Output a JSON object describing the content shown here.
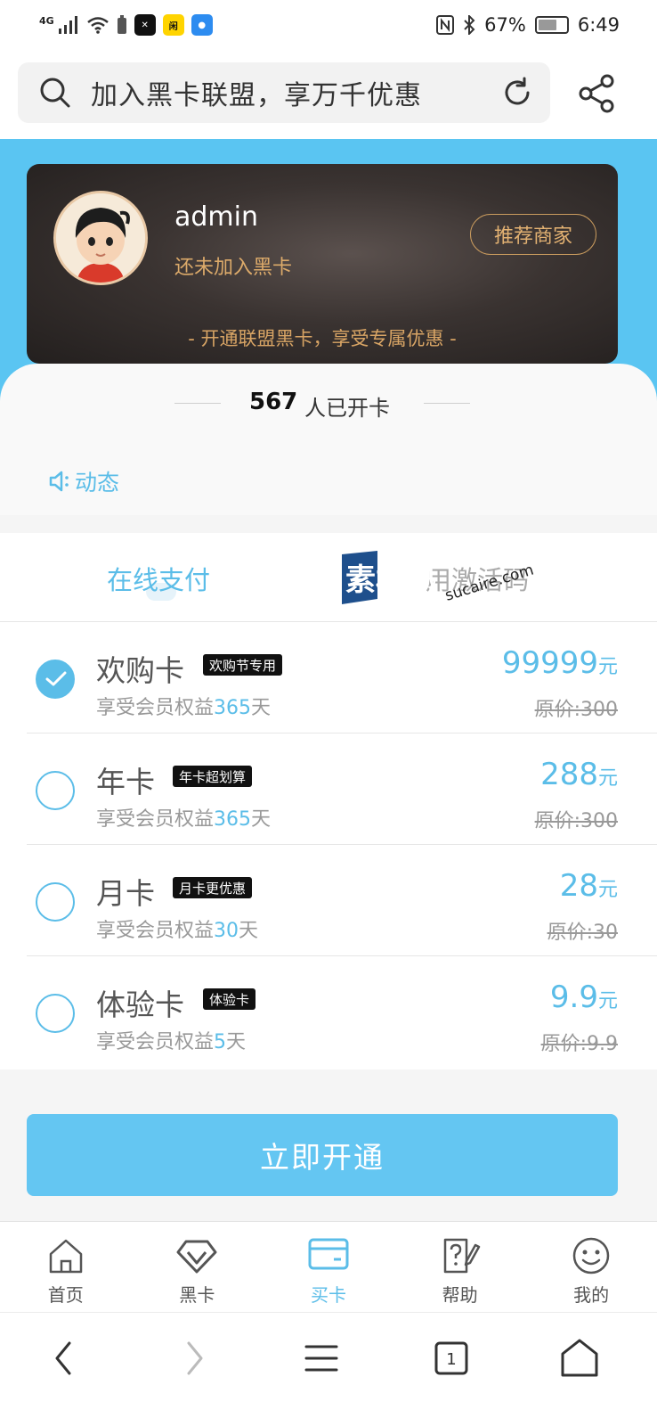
{
  "status_bar": {
    "network": "4G",
    "battery": "67%",
    "time": "6:49",
    "battery_level": 0.67
  },
  "search": {
    "placeholder": "加入黑卡联盟，享万千优惠"
  },
  "member_card": {
    "username": "admin",
    "status": "还未加入黑卡",
    "recommend_label": "推荐商家",
    "slogan": "- 开通联盟黑卡，享受专属优惠 -"
  },
  "stats": {
    "count": "567",
    "label": "人已开卡"
  },
  "news": {
    "label": "动态"
  },
  "tabs": {
    "online": "在线支付",
    "code": "用激活码"
  },
  "watermark": {
    "main": "素材熱",
    "sub": "sucaire.com"
  },
  "plans": [
    {
      "name": "欢购卡",
      "tag": "欢购节专用",
      "desc_prefix": "享受会员权益",
      "days": "365",
      "desc_suffix": "天",
      "price": "99999",
      "unit": "元",
      "original": "原价:300",
      "selected": true
    },
    {
      "name": "年卡",
      "tag": "年卡超划算",
      "desc_prefix": "享受会员权益",
      "days": "365",
      "desc_suffix": "天",
      "price": "288",
      "unit": "元",
      "original": "原价:300",
      "selected": false
    },
    {
      "name": "月卡",
      "tag": "月卡更优惠",
      "desc_prefix": "享受会员权益",
      "days": "30",
      "desc_suffix": "天",
      "price": "28",
      "unit": "元",
      "original": "原价:30",
      "selected": false
    },
    {
      "name": "体验卡",
      "tag": "体验卡",
      "desc_prefix": "享受会员权益",
      "days": "5",
      "desc_suffix": "天",
      "price": "9.9",
      "unit": "元",
      "original": "原价:9.9",
      "selected": false
    }
  ],
  "cta": {
    "label": "立即开通"
  },
  "bottom_nav": [
    {
      "label": "首页",
      "icon": "home-icon",
      "active": false
    },
    {
      "label": "黑卡",
      "icon": "diamond-icon",
      "active": false
    },
    {
      "label": "买卡",
      "icon": "card-icon",
      "active": true
    },
    {
      "label": "帮助",
      "icon": "help-icon",
      "active": false
    },
    {
      "label": "我的",
      "icon": "smile-icon",
      "active": false
    }
  ],
  "system_nav": {
    "tab_count": "1"
  },
  "colors": {
    "accent": "#5bbde8",
    "band": "#5ac5f2",
    "gold": "#dcaa6a",
    "cta": "#64c6f2"
  }
}
